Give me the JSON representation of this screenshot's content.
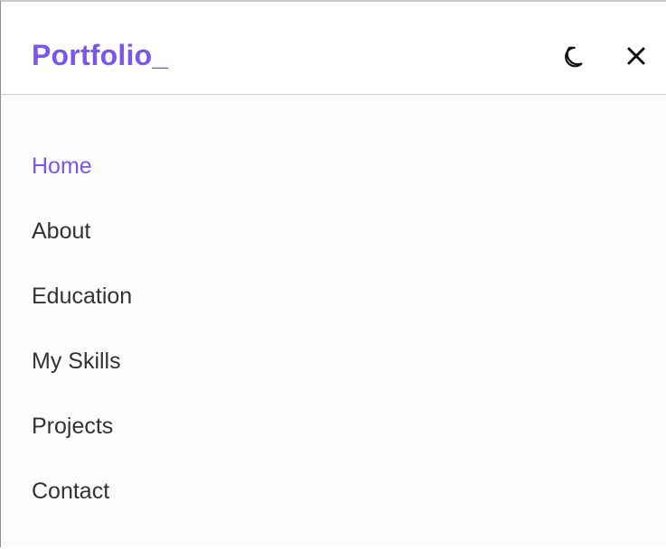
{
  "brand": {
    "logo": "Portfolio_",
    "accent_color": "#7b55ef"
  },
  "header": {
    "theme_icon": "moon-icon",
    "close_icon": "close-icon"
  },
  "menu": {
    "items": [
      {
        "label": "Home",
        "active": true
      },
      {
        "label": "About",
        "active": false
      },
      {
        "label": "Education",
        "active": false
      },
      {
        "label": "My Skills",
        "active": false
      },
      {
        "label": "Projects",
        "active": false
      },
      {
        "label": "Contact",
        "active": false
      }
    ]
  },
  "colors": {
    "text": "#333333",
    "divider": "#cfcfcf",
    "background": "#fcfcfd"
  }
}
